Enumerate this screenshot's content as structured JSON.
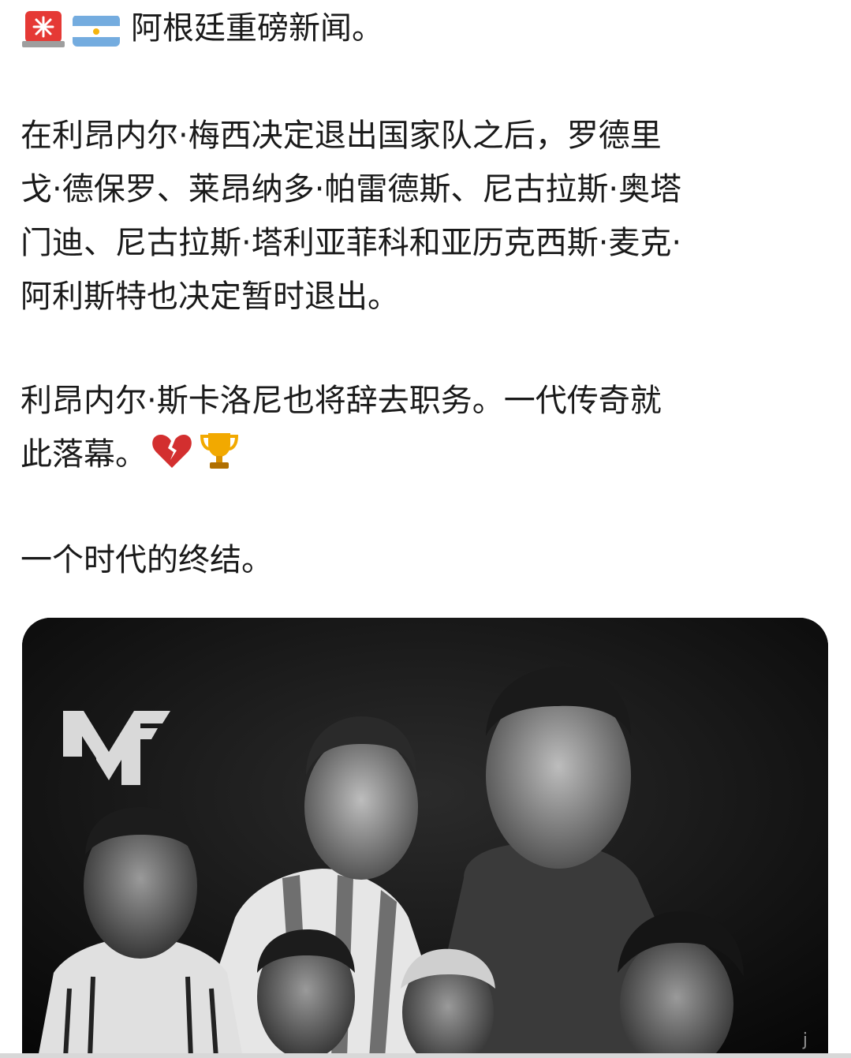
{
  "post": {
    "headline_icons": [
      "siren-icon",
      "argentina-flag-icon"
    ],
    "headline": "阿根廷重磅新闻。",
    "paragraph1": [
      "在利昂内尔·梅西决定退出国家队之后，罗德里",
      "戈·德保罗、莱昂纳多·帕雷德斯、尼古拉斯·奥塔",
      "门迪、尼古拉斯·塔利亚菲科和亚历克西斯·麦克·",
      "阿利斯特也决定暂时退出。"
    ],
    "paragraph2": [
      "利昂内尔·斯卡洛尼也将辞去职务。一代传奇就",
      "此落幕。"
    ],
    "paragraph2_icons": [
      "broken-heart-icon",
      "trophy-icon"
    ],
    "paragraph3": "一个时代的终结。",
    "image": {
      "description_icon": "team-photo",
      "logo": "MF",
      "watermark": "j"
    }
  },
  "colors": {
    "text": "#1a1a1a",
    "background": "#ffffff",
    "photo_bg": "#0b0b0b",
    "siren_red": "#e53935",
    "flag_blue": "#74acdf",
    "sun_yellow": "#f6b40e",
    "heart_red": "#d32f2f",
    "trophy_gold": "#f2a900"
  }
}
